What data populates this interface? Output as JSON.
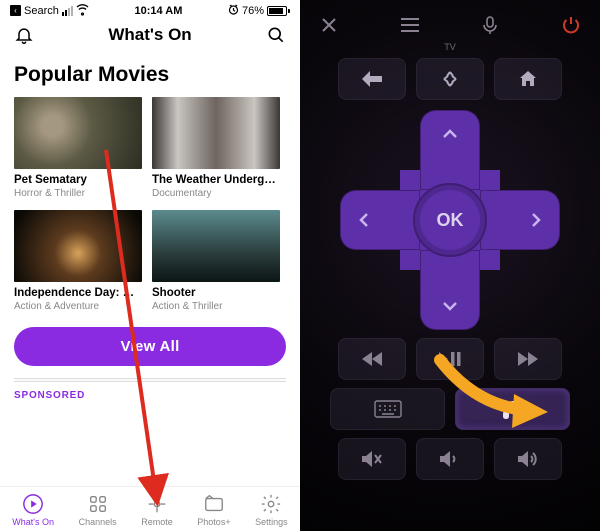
{
  "left": {
    "status": {
      "back_label": "Search",
      "time": "10:14 AM",
      "battery_pct": "76%"
    },
    "nav": {
      "title": "What's On"
    },
    "section_title": "Popular Movies",
    "movies": [
      {
        "title": "Pet Sematary",
        "genre": "Horror & Thriller"
      },
      {
        "title": "The Weather Undergro…",
        "genre": "Documentary"
      },
      {
        "title": "Independence Day: Res…",
        "genre": "Action & Adventure"
      },
      {
        "title": "Shooter",
        "genre": "Action & Thriller"
      }
    ],
    "view_all": "View All",
    "sponsored": "SPONSORED",
    "tabs": [
      {
        "label": "What's On"
      },
      {
        "label": "Channels"
      },
      {
        "label": "Remote"
      },
      {
        "label": "Photos+"
      },
      {
        "label": "Settings"
      }
    ]
  },
  "right": {
    "tv_label": "TV",
    "ok_label": "OK"
  },
  "colors": {
    "accent": "#8a2be2",
    "remote_purple": "#5d2fa8",
    "power_red": "#d0392a",
    "arrow_red": "#dd2b1f",
    "arrow_yellow": "#f5a623"
  }
}
